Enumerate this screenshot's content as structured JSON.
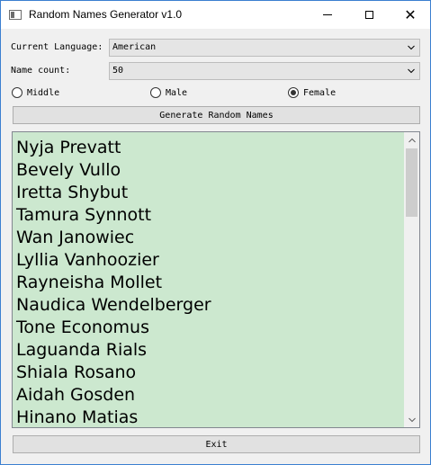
{
  "window": {
    "title": "Random Names Generator v1.0",
    "close_glyph": "✕"
  },
  "form": {
    "language_label": "Current Language:",
    "language_value": "American",
    "count_label": "Name count:",
    "count_value": "50"
  },
  "gender": {
    "options": [
      {
        "label": "Middle",
        "selected": false
      },
      {
        "label": "Male",
        "selected": false
      },
      {
        "label": "Female",
        "selected": true
      }
    ]
  },
  "actions": {
    "generate_label": "Generate Random Names",
    "exit_label": "Exit"
  },
  "names": [
    "Nyja Prevatt",
    "Bevely Vullo",
    "Iretta Shybut",
    "Tamura Synnott",
    "Wan Janowiec",
    "Lyllia Vanhoozier",
    "Rayneisha Mollet",
    "Naudica Wendelberger",
    "Tone Economus",
    "Laguanda Rials",
    "Shiala Rosano",
    "Aidah Gosden",
    "Hinano Matias"
  ],
  "colors": {
    "window_border": "#3b7fd0",
    "list_background": "#cce8cf",
    "button_face": "#e1e1e1"
  },
  "icons": {
    "app": "window-icon",
    "minimize": "minimize-icon",
    "maximize": "maximize-icon",
    "close": "close-icon",
    "dropdown": "chevron-down-icon",
    "scroll_up": "chevron-up-icon",
    "scroll_down": "chevron-down-icon"
  }
}
